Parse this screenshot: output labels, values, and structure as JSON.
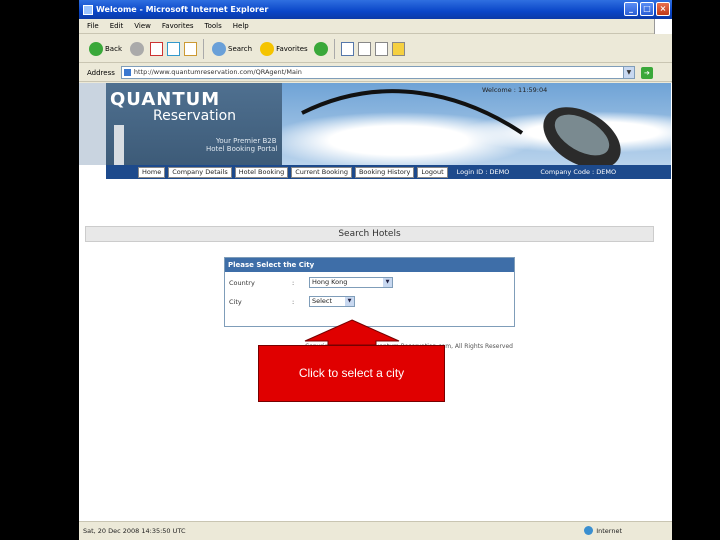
{
  "window": {
    "title": "Welcome - Microsoft Internet Explorer",
    "buttons": [
      "_",
      "□",
      "×"
    ]
  },
  "menu": [
    "File",
    "Edit",
    "View",
    "Favorites",
    "Tools",
    "Help"
  ],
  "toolbar": {
    "back": "Back",
    "search": "Search",
    "favorites": "Favorites"
  },
  "address": {
    "label": "Address",
    "url": "http://www.quantumreservation.com/QRAgent/Main",
    "go": "Go"
  },
  "banner": {
    "brand_name": "QUANTUM",
    "brand_sub": "Reservation",
    "tagline1": "Your Premier B2B",
    "tagline2": "Hotel Booking Portal",
    "welcome": "Welcome : 11:59:04"
  },
  "nav": {
    "buttons": [
      "Home",
      "Company Details",
      "Hotel Booking",
      "Current Booking",
      "Booking History",
      "Logout"
    ],
    "login_id": "Login ID : DEMO",
    "company": "Company Code : DEMO"
  },
  "search": {
    "header": "Search Hotels",
    "panel_title": "Please Select the City",
    "country_label": "Country",
    "country_value": "Hong Kong",
    "city_label": "City",
    "city_value": "Select",
    "colon": ":"
  },
  "copyright": "Copyright 2006-2007 Quantum Reservation.com, All Rights Reserved",
  "callout": {
    "text": "Click to select a city",
    "color": "#e00000"
  },
  "status": {
    "left": "Sat, 20 Dec 2008 14:35:50 UTC",
    "zone": "Internet"
  }
}
